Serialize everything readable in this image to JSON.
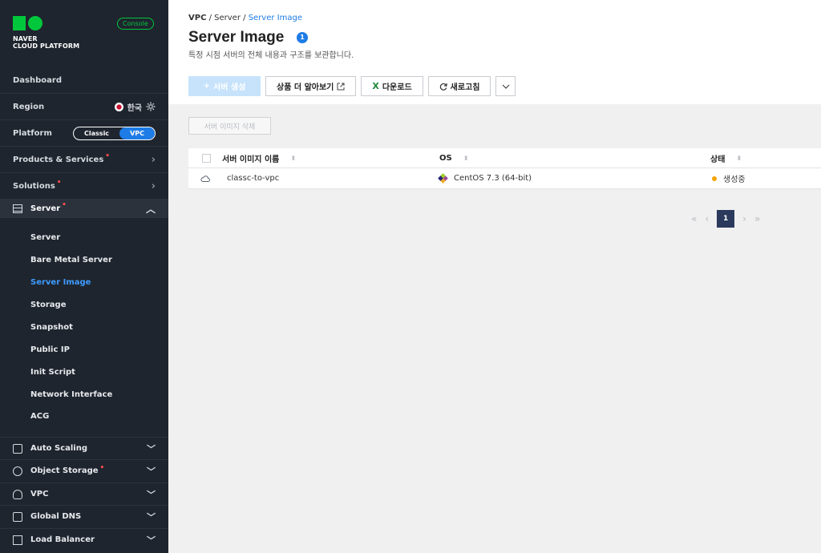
{
  "brand": {
    "line1": "NAVER",
    "line2": "CLOUD PLATFORM",
    "console_label": "Console"
  },
  "sidebar": {
    "dashboard": "Dashboard",
    "region_label": "Region",
    "region_value": "한국",
    "platform_label": "Platform",
    "platform_options": [
      "Classic",
      "VPC"
    ],
    "platform_selected": "VPC",
    "products_label": "Products & Services",
    "solutions_label": "Solutions",
    "server_section": "Server",
    "server_items": [
      {
        "label": "Server",
        "active": false
      },
      {
        "label": "Bare Metal Server",
        "active": false
      },
      {
        "label": "Server Image",
        "active": true
      },
      {
        "label": "Storage",
        "active": false
      },
      {
        "label": "Snapshot",
        "active": false
      },
      {
        "label": "Public IP",
        "active": false
      },
      {
        "label": "Init Script",
        "active": false
      },
      {
        "label": "Network Interface",
        "active": false
      },
      {
        "label": "ACG",
        "active": false
      }
    ],
    "sections": [
      {
        "label": "Auto Scaling",
        "required": false
      },
      {
        "label": "Object Storage",
        "required": true
      },
      {
        "label": "VPC",
        "required": false
      },
      {
        "label": "Global DNS",
        "required": false
      },
      {
        "label": "Load Balancer",
        "required": false
      }
    ]
  },
  "breadcrumb": [
    "VPC",
    "Server",
    "Server Image"
  ],
  "page": {
    "title": "Server Image",
    "info_badge": "1",
    "subtitle": "특정 시점 서버의 전체 내용과 구조를 보관합니다."
  },
  "toolbar": {
    "create_label": "서버 생성",
    "learn_more_label": "상품 더 알아보기",
    "download_label": "다운로드",
    "refresh_label": "새로고침"
  },
  "delete_button": "서버 이미지 삭제",
  "table": {
    "columns": [
      "서버 이미지 이름",
      "OS",
      "상태"
    ],
    "rows": [
      {
        "name": "classc-to-vpc",
        "os": "CentOS 7.3 (64-bit)",
        "status": "생성중"
      }
    ]
  },
  "pagination": {
    "current": "1"
  },
  "colors": {
    "accent": "#1e7ce6",
    "brand": "#00c73c",
    "sidebar_bg": "#1f252e",
    "status_creating": "#f5a300"
  }
}
